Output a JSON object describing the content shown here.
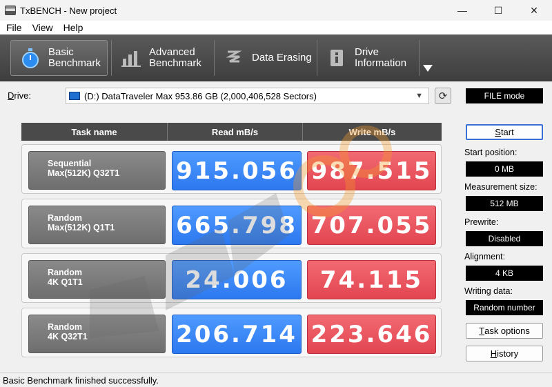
{
  "window": {
    "title": "TxBENCH - New project",
    "minimize": "—",
    "maximize": "☐",
    "close": "✕"
  },
  "menu": [
    "File",
    "View",
    "Help"
  ],
  "toolbar": {
    "tabs": [
      {
        "label": "Basic\nBenchmark",
        "icon": "stopwatch-icon",
        "active": true
      },
      {
        "label": "Advanced\nBenchmark",
        "icon": "bar-chart-icon",
        "active": false
      },
      {
        "label": "Data Erasing",
        "icon": "eraser-icon",
        "active": false
      },
      {
        "label": "Drive\nInformation",
        "icon": "drive-info-icon",
        "active": false
      }
    ]
  },
  "drive": {
    "label": "Drive:",
    "selected": "(D:) DataTraveler Max  953.86 GB (2,000,406,528 Sectors)",
    "mode": "FILE mode"
  },
  "results": {
    "headers": [
      "Task name",
      "Read mB/s",
      "Write mB/s"
    ],
    "rows": [
      {
        "task_line1": "Sequential",
        "task_line2": "Max(512K) Q32T1",
        "read": "915.056",
        "write": "987.515"
      },
      {
        "task_line1": "Random",
        "task_line2": "Max(512K) Q1T1",
        "read": "665.798",
        "write": "707.055"
      },
      {
        "task_line1": "Random",
        "task_line2": "4K Q1T1",
        "read": "24.006",
        "write": "74.115"
      },
      {
        "task_line1": "Random",
        "task_line2": "4K Q32T1",
        "read": "206.714",
        "write": "223.646"
      }
    ]
  },
  "side": {
    "start": "Start",
    "start_position_label": "Start position:",
    "start_position": "0 MB",
    "measurement_size_label": "Measurement size:",
    "measurement_size": "512 MB",
    "prewrite_label": "Prewrite:",
    "prewrite": "Disabled",
    "alignment_label": "Alignment:",
    "alignment": "4 KB",
    "writing_data_label": "Writing data:",
    "writing_data": "Random number",
    "task_options": "Task options",
    "history": "History"
  },
  "status": "Basic Benchmark finished successfully.",
  "colors": {
    "read": "#2c78ef",
    "write": "#e24550",
    "toolbar": "#4a4a4a"
  }
}
